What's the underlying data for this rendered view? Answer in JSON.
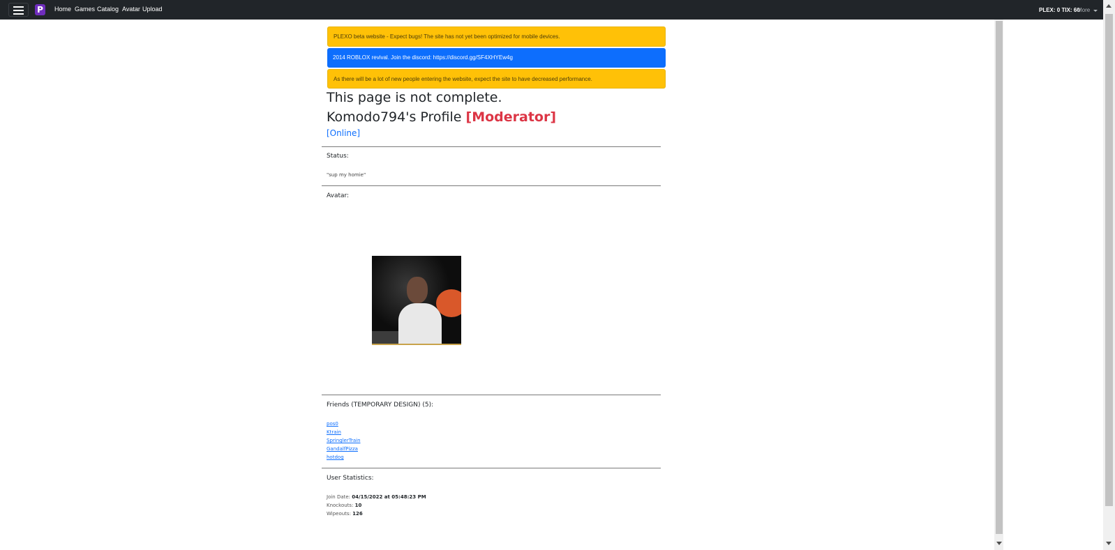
{
  "navbar": {
    "logo_letter": "P",
    "links": [
      "Home",
      "Games",
      "Catalog",
      "Avatar",
      "Upload"
    ],
    "currency": "PLEX: 0 TIX: 60",
    "more_label": "More"
  },
  "alerts": [
    {
      "type": "warning",
      "text": "PLEXO beta website - Expect bugs! The site has not yet been optimized for mobile devices."
    },
    {
      "type": "primary",
      "text": "2014 ROBLOX revival. Join the discord: https://discord.gg/SF4XHYEw4g"
    },
    {
      "type": "warning",
      "text": "As there will be a lot of new people entering the website, expect the site to have decreased performance."
    }
  ],
  "page": {
    "incomplete_notice": "This page is not complete.",
    "profile_title": "Komodo794's Profile",
    "role_badge": "[Moderator]",
    "online_status": "[Online]"
  },
  "status": {
    "title": "Status:",
    "text": "\"sup my homie\""
  },
  "avatar": {
    "title": "Avatar:"
  },
  "friends": {
    "title": "Friends (TEMPORARY DESIGN) (5):",
    "items": [
      "pos0",
      "Ktrain",
      "SpringlerTrain",
      "GandalfPizza",
      "hotdog"
    ]
  },
  "stats": {
    "title": "User Statistics:",
    "join_label": "Join Date:",
    "join_value": "04/15/2022 at 05:48:23 PM",
    "knockouts_label": "Knockouts:",
    "knockouts_value": "10",
    "wipeouts_label": "Wipeouts:",
    "wipeouts_value": "126"
  },
  "colors": {
    "navbar": "#212529",
    "warning": "#ffc107",
    "primary": "#0d6efd",
    "danger": "#dc3545"
  }
}
